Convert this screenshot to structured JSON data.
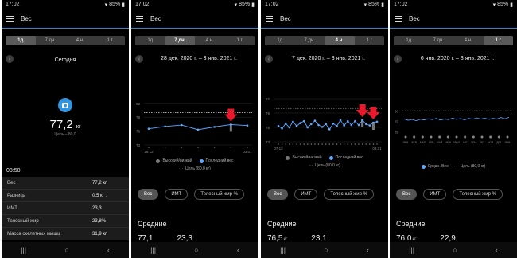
{
  "colors": {
    "accent": "#2b8bd7",
    "series": "#5fa8ff",
    "arrow": "#e8192c",
    "highlow": "#7a7a7a"
  },
  "common": {
    "time": "17:02",
    "battery": "85%",
    "app_title": "Вес",
    "tabs": [
      "1д",
      "7 дн.",
      "4 н.",
      "1 г"
    ],
    "nav_icons": [
      "recent-apps-icon",
      "home-icon",
      "back-icon"
    ]
  },
  "screen1": {
    "active_tab": 0,
    "day_label": "Сегодня",
    "weight_value": "77,2",
    "weight_unit": "кг",
    "goal": "Цель – 80,0",
    "time_label": "08:50",
    "stats": [
      {
        "label": "Вес",
        "value": "77,2 кг",
        "trend": ""
      },
      {
        "label": "Разница",
        "value": "0,5 кг",
        "trend": "↓"
      },
      {
        "label": "ИМТ",
        "value": "23,3",
        "trend": ""
      },
      {
        "label": "Телесный жир",
        "value": "23,8%",
        "trend": ""
      },
      {
        "label": "Масса скелетных мышц",
        "value": "31,9 кг",
        "trend": ""
      }
    ]
  },
  "screen2": {
    "active_tab": 1,
    "period": "28 дек. 2020 г. – 3 янв. 2021 г.",
    "y_ticks": [
      "82",
      "79",
      "76",
      "73"
    ],
    "x_ticks": [
      "28.12",
      "03.01"
    ],
    "legend_highlow": "Высокий/низкий",
    "legend_last": "Последний вес",
    "legend_goal": "Цель (80,0 кг)",
    "pills": [
      "Вес",
      "ИМТ",
      "Телесный жир %"
    ],
    "section": "Средние",
    "avg1": "77,1",
    "avg2": "23,3"
  },
  "screen3": {
    "active_tab": 2,
    "period": "7 дек. 2020 г. – 3 янв. 2021 г.",
    "y_ticks": [
      "82",
      "79",
      "76",
      "73"
    ],
    "x_ticks": [
      "07.12",
      "03.01"
    ],
    "legend_highlow": "Высокий/низкий",
    "legend_last": "Последний вес",
    "legend_goal": "Цель (80,0 кг)",
    "pills": [
      "Вес",
      "ИМТ",
      "Телесный жир %"
    ],
    "section": "Средние",
    "avg1": "76,5",
    "avg1_unit": "кг",
    "avg2": "23,1"
  },
  "screen4": {
    "active_tab": 3,
    "period": "6 янв. 2020 г. – 3 янв. 2021 г.",
    "y_ticks": [
      "80",
      "75",
      "70"
    ],
    "months": [
      "ЯНВ",
      "ФЕВ",
      "МАР",
      "АПР",
      "МАЙ",
      "ИЮН",
      "ИЮЛ",
      "АВГ",
      "СЕН",
      "ОКТ",
      "НОЯ",
      "ДЕК",
      "ЯНВ"
    ],
    "legend_avg": "Средн. Вес",
    "legend_goal": "Цель (80,0 кг)",
    "pills": [
      "Вес",
      "ИМТ",
      "Телесный жир %"
    ],
    "section": "Средние",
    "avg1": "76,0",
    "avg1_unit": "кг",
    "avg2": "22,9"
  },
  "chart_data": [
    {
      "type": "line",
      "title": "28 дек. 2020 г. – 3 янв. 2021 г.",
      "ylim": [
        73,
        83
      ],
      "goal": 80,
      "series": [
        {
          "name": "Последний вес",
          "values": [
            76.5,
            77.0,
            77.3,
            76.3,
            76.9,
            77.4,
            77.2
          ]
        }
      ],
      "highlow_index": 5,
      "legend": [
        "Высокий/низкий",
        "Последний вес",
        "Цель (80,0 кг)"
      ]
    },
    {
      "type": "line",
      "title": "7 дек. 2020 г. – 3 янв. 2021 г.",
      "ylim": [
        73,
        83
      ],
      "goal": 80,
      "series": [
        {
          "name": "Последний вес",
          "values": [
            76.3,
            75.8,
            76.8,
            76.0,
            77.2,
            76.3,
            76.9,
            77.3,
            76.0,
            76.7,
            77.4,
            76.5,
            76.1,
            76.7,
            75.6,
            76.8,
            76.3,
            77.5,
            76.4,
            77.3,
            76.5,
            77.3,
            76.5,
            77.5,
            76.7,
            76.4,
            77.0,
            77.2
          ]
        }
      ],
      "highlow_index": [
        23,
        26
      ],
      "legend": [
        "Высокий/низкий",
        "Последний вес",
        "Цель (80,0 кг)"
      ]
    },
    {
      "type": "line",
      "title": "6 янв. 2020 г. – 3 янв. 2021 г.",
      "ylim": [
        70,
        82
      ],
      "goal": 80,
      "series": [
        {
          "name": "Средн. Вес",
          "values": [
            76.2,
            75.6,
            76.0,
            75.4,
            76.1,
            75.8,
            76.3,
            75.9,
            76.5,
            75.7,
            76.2,
            75.9,
            76.6,
            76.0,
            76.4,
            75.8,
            76.5,
            76.1,
            76.7,
            76.2,
            76.6,
            76.0,
            76.5,
            76.2,
            76.9,
            76.3,
            77.0
          ]
        }
      ],
      "legend": [
        "Средн. Вес",
        "Цель (80,0 кг)"
      ]
    }
  ]
}
